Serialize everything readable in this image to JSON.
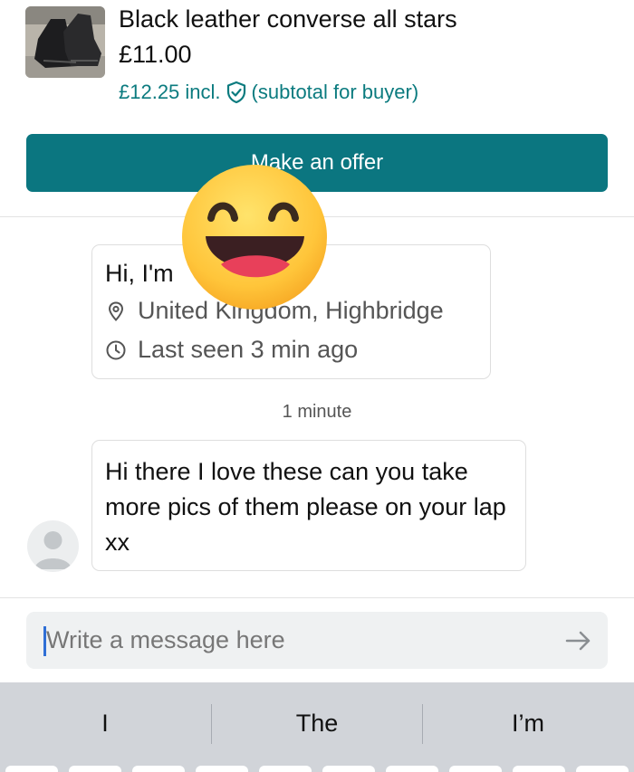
{
  "product": {
    "title": "Black leather converse all stars",
    "price": "£11.00",
    "price_incl": "£12.25 incl.",
    "buyer_note": "(subtotal for buyer)",
    "accent_color": "#0b7b7f"
  },
  "actions": {
    "make_offer_label": "Make an offer",
    "button_color": "#0b7680"
  },
  "user_card": {
    "greeting": "Hi, I'm",
    "location": "United Kingdom, Highbridge",
    "last_seen": "Last seen 3 min ago"
  },
  "chat": {
    "timestamp": "1 minute",
    "message": "Hi there I love these can you take more pics of them please on your lap xx"
  },
  "composer": {
    "placeholder": "Write a message here"
  },
  "keyboard": {
    "suggestions": [
      "I",
      "The",
      "I’m"
    ]
  },
  "icons": {
    "shield": "shield-check-icon",
    "location": "location-pin-icon",
    "clock": "clock-icon",
    "send": "arrow-right-icon",
    "emoji": "grinning-face-emoji"
  }
}
